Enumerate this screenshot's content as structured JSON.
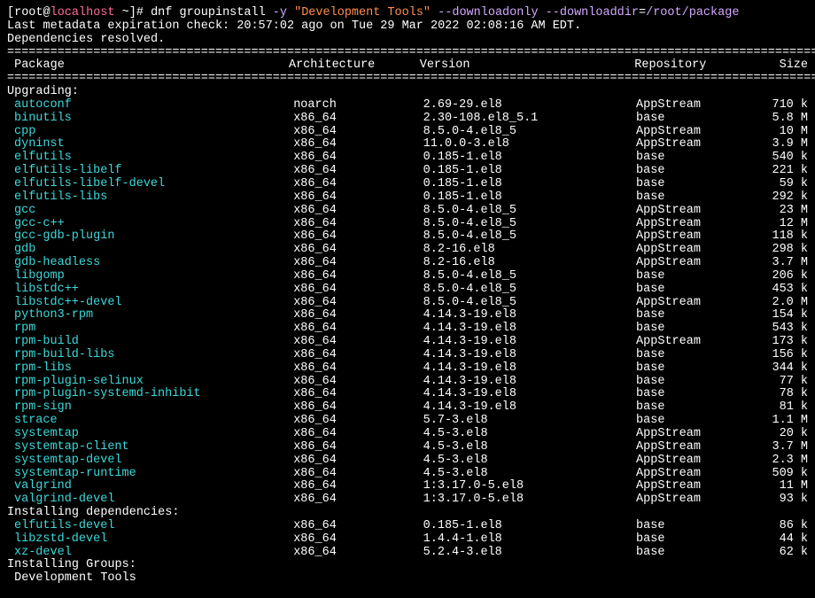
{
  "prompt": {
    "bracket_open": "[",
    "user": "root@",
    "host": "localhost",
    "path": " ~",
    "bracket_close": "]# ",
    "command": "dnf groupinstall ",
    "opt_y": "-y ",
    "arg_string": "\"Development Tools\" ",
    "opt_downloadonly": "--downloadonly ",
    "opt_downloaddir": "--downloaddir",
    "equals": "=",
    "download_path": "/root/package"
  },
  "metadata_check": "Last metadata expiration check: 20:57:02 ago on Tue 29 Mar 2022 02:08:16 AM EDT.",
  "deps_resolved": "Dependencies resolved.",
  "headers": {
    "package": " Package",
    "architecture": "Architecture",
    "version": "Version",
    "repository": "Repository",
    "size": "Size"
  },
  "sections": {
    "upgrading": "Upgrading:",
    "installing_deps": "Installing dependencies:",
    "installing_groups": "Installing Groups:",
    "dev_tools": " Development Tools"
  },
  "upgrading_packages": [
    {
      "name": "autoconf",
      "arch": "noarch",
      "version": "2.69-29.el8",
      "repo": "AppStream",
      "size": "710 k"
    },
    {
      "name": "binutils",
      "arch": "x86_64",
      "version": "2.30-108.el8_5.1",
      "repo": "base",
      "size": "5.8 M"
    },
    {
      "name": "cpp",
      "arch": "x86_64",
      "version": "8.5.0-4.el8_5",
      "repo": "AppStream",
      "size": "10 M"
    },
    {
      "name": "dyninst",
      "arch": "x86_64",
      "version": "11.0.0-3.el8",
      "repo": "AppStream",
      "size": "3.9 M"
    },
    {
      "name": "elfutils",
      "arch": "x86_64",
      "version": "0.185-1.el8",
      "repo": "base",
      "size": "540 k"
    },
    {
      "name": "elfutils-libelf",
      "arch": "x86_64",
      "version": "0.185-1.el8",
      "repo": "base",
      "size": "221 k"
    },
    {
      "name": "elfutils-libelf-devel",
      "arch": "x86_64",
      "version": "0.185-1.el8",
      "repo": "base",
      "size": "59 k"
    },
    {
      "name": "elfutils-libs",
      "arch": "x86_64",
      "version": "0.185-1.el8",
      "repo": "base",
      "size": "292 k"
    },
    {
      "name": "gcc",
      "arch": "x86_64",
      "version": "8.5.0-4.el8_5",
      "repo": "AppStream",
      "size": "23 M"
    },
    {
      "name": "gcc-c++",
      "arch": "x86_64",
      "version": "8.5.0-4.el8_5",
      "repo": "AppStream",
      "size": "12 M"
    },
    {
      "name": "gcc-gdb-plugin",
      "arch": "x86_64",
      "version": "8.5.0-4.el8_5",
      "repo": "AppStream",
      "size": "118 k"
    },
    {
      "name": "gdb",
      "arch": "x86_64",
      "version": "8.2-16.el8",
      "repo": "AppStream",
      "size": "298 k"
    },
    {
      "name": "gdb-headless",
      "arch": "x86_64",
      "version": "8.2-16.el8",
      "repo": "AppStream",
      "size": "3.7 M"
    },
    {
      "name": "libgomp",
      "arch": "x86_64",
      "version": "8.5.0-4.el8_5",
      "repo": "base",
      "size": "206 k"
    },
    {
      "name": "libstdc++",
      "arch": "x86_64",
      "version": "8.5.0-4.el8_5",
      "repo": "base",
      "size": "453 k"
    },
    {
      "name": "libstdc++-devel",
      "arch": "x86_64",
      "version": "8.5.0-4.el8_5",
      "repo": "AppStream",
      "size": "2.0 M"
    },
    {
      "name": "python3-rpm",
      "arch": "x86_64",
      "version": "4.14.3-19.el8",
      "repo": "base",
      "size": "154 k"
    },
    {
      "name": "rpm",
      "arch": "x86_64",
      "version": "4.14.3-19.el8",
      "repo": "base",
      "size": "543 k"
    },
    {
      "name": "rpm-build",
      "arch": "x86_64",
      "version": "4.14.3-19.el8",
      "repo": "AppStream",
      "size": "173 k"
    },
    {
      "name": "rpm-build-libs",
      "arch": "x86_64",
      "version": "4.14.3-19.el8",
      "repo": "base",
      "size": "156 k"
    },
    {
      "name": "rpm-libs",
      "arch": "x86_64",
      "version": "4.14.3-19.el8",
      "repo": "base",
      "size": "344 k"
    },
    {
      "name": "rpm-plugin-selinux",
      "arch": "x86_64",
      "version": "4.14.3-19.el8",
      "repo": "base",
      "size": "77 k"
    },
    {
      "name": "rpm-plugin-systemd-inhibit",
      "arch": "x86_64",
      "version": "4.14.3-19.el8",
      "repo": "base",
      "size": "78 k"
    },
    {
      "name": "rpm-sign",
      "arch": "x86_64",
      "version": "4.14.3-19.el8",
      "repo": "base",
      "size": "81 k"
    },
    {
      "name": "strace",
      "arch": "x86_64",
      "version": "5.7-3.el8",
      "repo": "base",
      "size": "1.1 M"
    },
    {
      "name": "systemtap",
      "arch": "x86_64",
      "version": "4.5-3.el8",
      "repo": "AppStream",
      "size": "20 k"
    },
    {
      "name": "systemtap-client",
      "arch": "x86_64",
      "version": "4.5-3.el8",
      "repo": "AppStream",
      "size": "3.7 M"
    },
    {
      "name": "systemtap-devel",
      "arch": "x86_64",
      "version": "4.5-3.el8",
      "repo": "AppStream",
      "size": "2.3 M"
    },
    {
      "name": "systemtap-runtime",
      "arch": "x86_64",
      "version": "4.5-3.el8",
      "repo": "AppStream",
      "size": "509 k"
    },
    {
      "name": "valgrind",
      "arch": "x86_64",
      "version": "1:3.17.0-5.el8",
      "repo": "AppStream",
      "size": "11 M"
    },
    {
      "name": "valgrind-devel",
      "arch": "x86_64",
      "version": "1:3.17.0-5.el8",
      "repo": "AppStream",
      "size": "93 k"
    }
  ],
  "installing_deps_packages": [
    {
      "name": "elfutils-devel",
      "arch": "x86_64",
      "version": "0.185-1.el8",
      "repo": "base",
      "size": "86 k"
    },
    {
      "name": "libzstd-devel",
      "arch": "x86_64",
      "version": "1.4.4-1.el8",
      "repo": "base",
      "size": "44 k"
    },
    {
      "name": "xz-devel",
      "arch": "x86_64",
      "version": "5.2.4-3.el8",
      "repo": "base",
      "size": "62 k"
    }
  ]
}
